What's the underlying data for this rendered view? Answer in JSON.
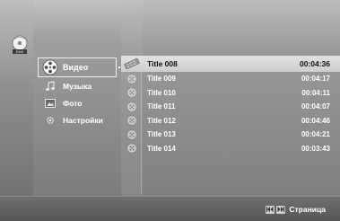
{
  "brand": {
    "logo_text": "DVD"
  },
  "menu": [
    {
      "label": "Видео",
      "icon": "film-reel-icon",
      "selected": true
    },
    {
      "label": "Музыка",
      "icon": "music-note-icon",
      "selected": false
    },
    {
      "label": "Фото",
      "icon": "photo-icon",
      "selected": false
    },
    {
      "label": "Настройки",
      "icon": "settings-gear-icon",
      "selected": false
    }
  ],
  "files": [
    {
      "title": "Title 008",
      "duration": "00:04:36",
      "selected": true
    },
    {
      "title": "Title 009",
      "duration": "00:04:17"
    },
    {
      "title": "Title 010",
      "duration": "00:04:11"
    },
    {
      "title": "Title 011",
      "duration": "00:04:07"
    },
    {
      "title": "Title 012",
      "duration": "00:04:46"
    },
    {
      "title": "Title 013",
      "duration": "00:04:21"
    },
    {
      "title": "Title 014",
      "duration": "00:03:43"
    }
  ],
  "footer": {
    "page_label": "Страница",
    "prev_icon": "skip-back-icon",
    "next_icon": "skip-forward-icon"
  }
}
